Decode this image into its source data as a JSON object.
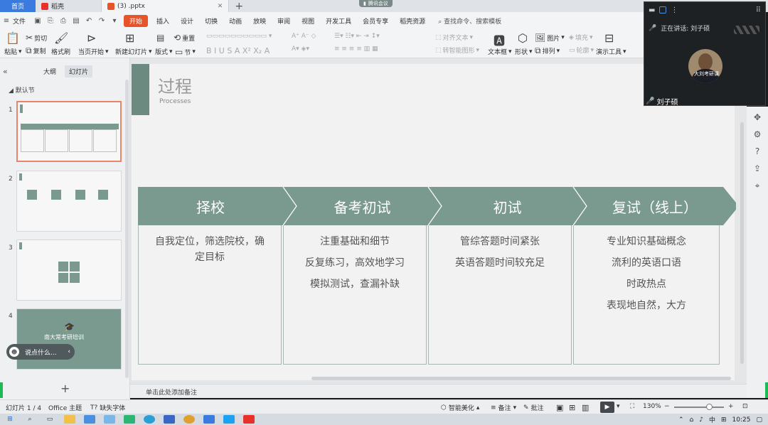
{
  "tabs": {
    "home": "首页",
    "items": [
      {
        "label": "稻壳",
        "color": "#e8312a"
      },
      {
        "label": "(3) .pptx",
        "color": "#e8542a"
      }
    ],
    "meeting_pill": "腾讯会议"
  },
  "menu": {
    "file": "文件",
    "items": [
      "开始",
      "插入",
      "设计",
      "切换",
      "动画",
      "放映",
      "审阅",
      "视图",
      "开发工具",
      "会员专享",
      "稻壳资源"
    ],
    "search_placeholder": "查找命令、搜索模板"
  },
  "ribbon": {
    "paste": "粘贴",
    "cut": "剪切",
    "copy": "复制",
    "format_painter": "格式刷",
    "from_current": "当页开始",
    "new_slide": "新建幻灯片",
    "layout": "版式",
    "section": "节",
    "reset": "重置",
    "font_controls": "B  I  U  S  A  X²  X₂  A",
    "align_text": "对齐文本",
    "convert_smartart": "转智能图形",
    "textbox": "文本框",
    "shape": "形状",
    "arrange": "排列",
    "picture": "图片",
    "fill": "填充",
    "outline": "轮廓",
    "present_tool": "演示工具"
  },
  "panel": {
    "outline_tab": "大纲",
    "slides_tab": "幻灯片",
    "section": "默认节",
    "slide_numbers": [
      "1",
      "2",
      "3",
      "4"
    ],
    "slide4_text": "南大常考研培训",
    "assistant": "说点什么..."
  },
  "slide": {
    "title": "过程",
    "subtitle": "Processes",
    "steps": [
      {
        "header": "择校",
        "lines": [
          "自我定位，筛选院校，确",
          "定目标"
        ]
      },
      {
        "header": "备考初试",
        "lines": [
          "注重基础和细节",
          "反复练习，高效地学习",
          "模拟测试，查漏补缺"
        ]
      },
      {
        "header": "初试",
        "lines": [
          "管综答题时间紧张",
          "英语答题时间较充足"
        ]
      },
      {
        "header": "复试（线上）",
        "lines": [
          "专业知识基础概念",
          "流利的英语口语",
          "时政热点",
          "表现地自然，大方"
        ]
      }
    ],
    "accent_color": "#7b9a8f"
  },
  "notes_placeholder": "单击此处添加备注",
  "status": {
    "slide_count": "幻灯片 1 / 4",
    "theme": "Office 主题",
    "missing_font": "缺失字体",
    "smart_beautify": "智能美化",
    "notes": "备注",
    "comments": "批注",
    "zoom": "130%",
    "zoom_percent": 70
  },
  "taskbar": {
    "ime": "中",
    "time": "10:25"
  },
  "video": {
    "speaking_label": "正在讲话: 刘子硕",
    "name": "刘子硕",
    "avatar_badge": "大刘考研课"
  }
}
